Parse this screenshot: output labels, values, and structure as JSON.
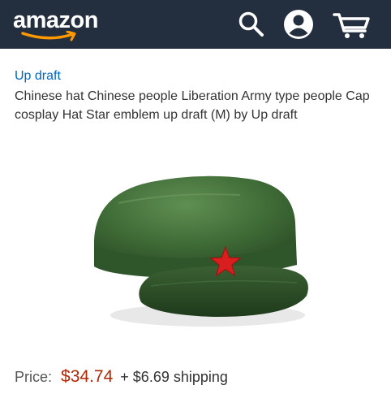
{
  "header": {
    "logo_text": "amazon",
    "icons": [
      "search-icon",
      "account-icon",
      "cart-icon"
    ],
    "background_color": "#232f3e",
    "logo_smile_color": "#ff9900"
  },
  "product": {
    "brand": "Up draft",
    "title": "Chinese hat Chinese people Liberation Army type people Cap cosplay Hat Star emblem up draft (M) by Up draft",
    "price_label": "Price:",
    "price": "$34.74",
    "shipping": "+ $6.69 shipping",
    "price_color": "#b12704",
    "brand_color": "#0066c0"
  }
}
